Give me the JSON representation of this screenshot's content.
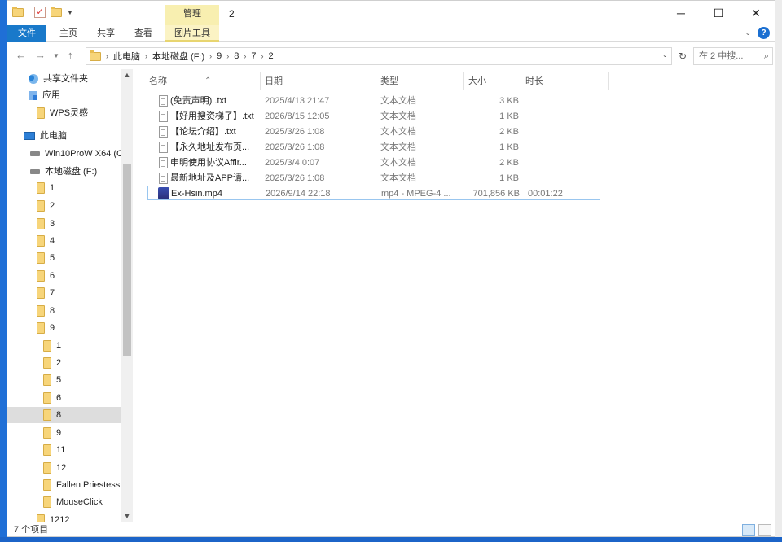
{
  "window": {
    "title": "2",
    "context_tab_header": "管理"
  },
  "ribbon": {
    "tabs": [
      "文件",
      "主页",
      "共享",
      "查看",
      "图片工具"
    ]
  },
  "address": {
    "crumbs": [
      "此电脑",
      "本地磁盘 (F:)",
      "9",
      "8",
      "7",
      "2"
    ]
  },
  "search": {
    "placeholder": "在 2 中搜..."
  },
  "nav": {
    "items": [
      {
        "label": "共享文件夹",
        "icon": "share-icon"
      },
      {
        "label": "应用",
        "icon": "apps-icon"
      },
      {
        "label": "WPS灵感",
        "icon": "folder-icon"
      },
      {
        "label": "此电脑",
        "icon": "pc-icon"
      },
      {
        "label": "Win10ProW X64 (C",
        "icon": "drive-icon"
      },
      {
        "label": "本地磁盘 (F:)",
        "icon": "drive-icon"
      },
      {
        "label": "1",
        "icon": "folder-icon"
      },
      {
        "label": "2",
        "icon": "folder-icon"
      },
      {
        "label": "3",
        "icon": "folder-icon"
      },
      {
        "label": "4",
        "icon": "folder-icon"
      },
      {
        "label": "5",
        "icon": "folder-icon"
      },
      {
        "label": "6",
        "icon": "folder-icon"
      },
      {
        "label": "7",
        "icon": "folder-icon"
      },
      {
        "label": "8",
        "icon": "folder-icon"
      },
      {
        "label": "9",
        "icon": "folder-icon"
      },
      {
        "label": "1",
        "icon": "folder-icon"
      },
      {
        "label": "2",
        "icon": "folder-icon"
      },
      {
        "label": "5",
        "icon": "folder-icon"
      },
      {
        "label": "6",
        "icon": "folder-icon"
      },
      {
        "label": "8",
        "icon": "folder-icon"
      },
      {
        "label": "9",
        "icon": "folder-icon"
      },
      {
        "label": "11",
        "icon": "folder-icon"
      },
      {
        "label": "12",
        "icon": "folder-icon"
      },
      {
        "label": "Fallen Priestess",
        "icon": "folder-icon"
      },
      {
        "label": "MouseClick",
        "icon": "folder-icon"
      },
      {
        "label": "1212",
        "icon": "folder-icon"
      }
    ]
  },
  "columns": {
    "name": "名称",
    "date": "日期",
    "type": "类型",
    "size": "大小",
    "duration": "时长"
  },
  "files": [
    {
      "name": "(免责声明) .txt",
      "date": "2025/4/13 21:47",
      "type": "文本文档",
      "size": "3 KB",
      "duration": ""
    },
    {
      "name": "【好用搜资梯子】.txt",
      "date": "2026/8/15 12:05",
      "type": "文本文档",
      "size": "1 KB",
      "duration": ""
    },
    {
      "name": "【论坛介绍】.txt",
      "date": "2025/3/26 1:08",
      "type": "文本文档",
      "size": "2 KB",
      "duration": ""
    },
    {
      "name": "【永久地址发布页...",
      "date": "2025/3/26 1:08",
      "type": "文本文档",
      "size": "1 KB",
      "duration": ""
    },
    {
      "name": "申明使用协议Affir...",
      "date": "2025/3/4 0:07",
      "type": "文本文档",
      "size": "2 KB",
      "duration": ""
    },
    {
      "name": "最新地址及APP请...",
      "date": "2025/3/26 1:08",
      "type": "文本文档",
      "size": "1 KB",
      "duration": ""
    },
    {
      "name": "Ex-Hsin.mp4",
      "date": "2026/9/14 22:18",
      "type": "mp4 - MPEG-4 ...",
      "size": "701,856 KB",
      "duration": "00:01:22"
    }
  ],
  "status": {
    "item_count": "7 个项目"
  }
}
